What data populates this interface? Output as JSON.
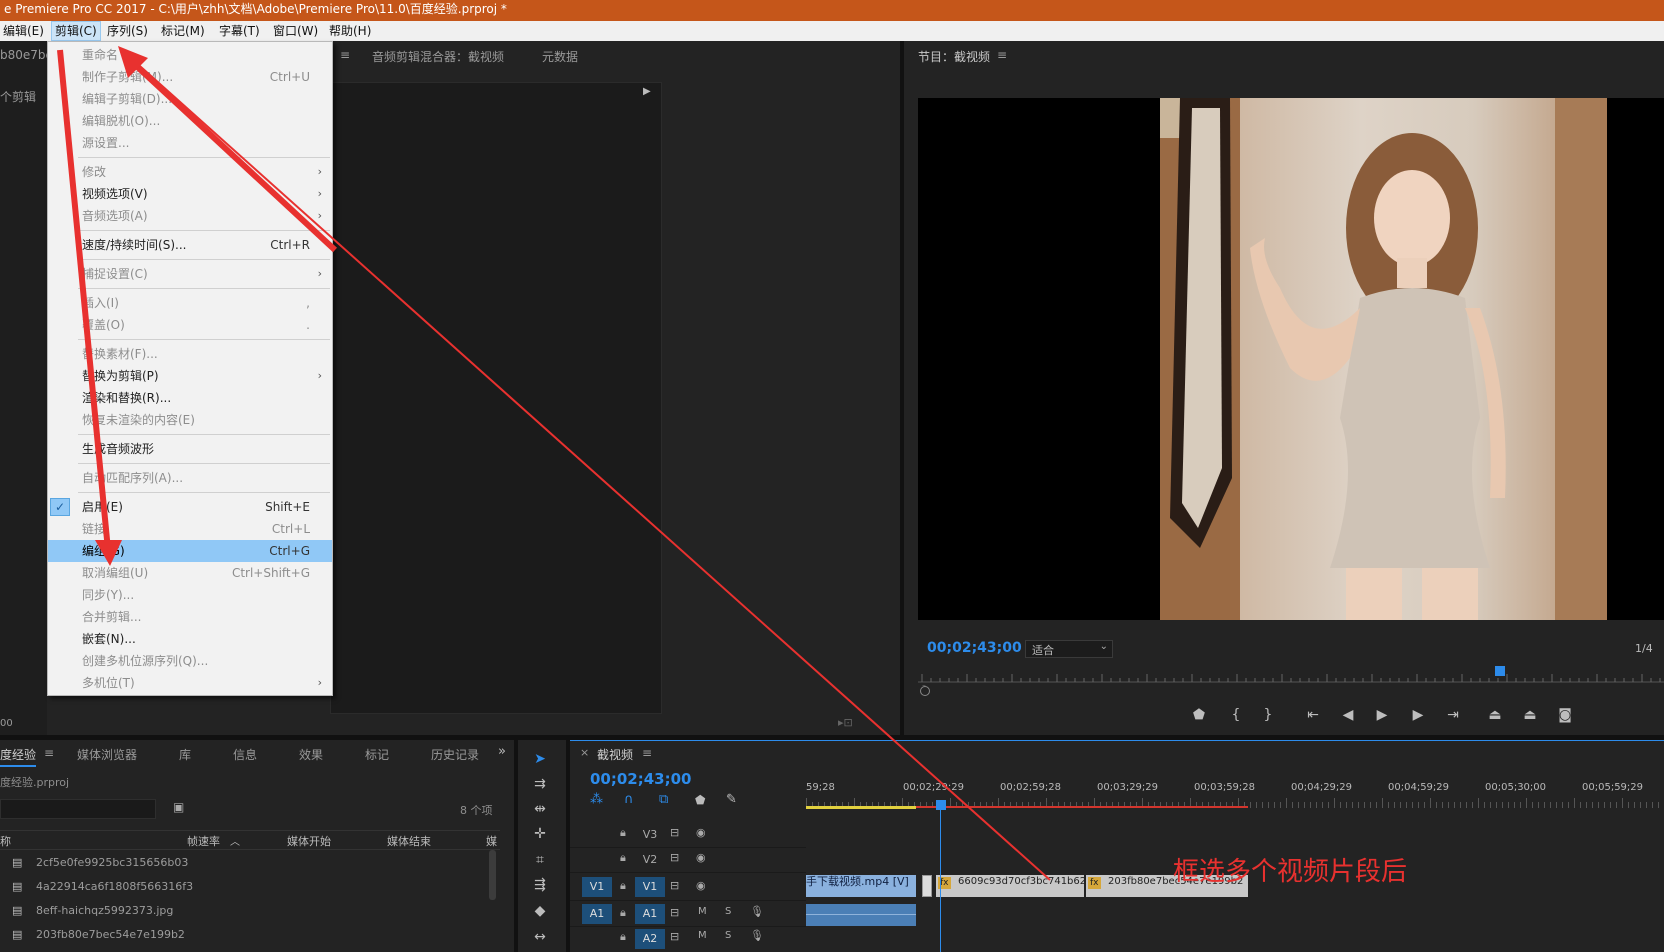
{
  "window": {
    "title": "e Premiere Pro CC 2017 - C:\\用户\\zhh\\文档\\Adobe\\Premiere Pro\\11.0\\百度经验.prproj *"
  },
  "menubar": {
    "items": [
      "编辑(E)",
      "剪辑(C)",
      "序列(S)",
      "标记(M)",
      "字幕(T)",
      "窗口(W)",
      "帮助(H)"
    ],
    "active": "剪辑(C)"
  },
  "source_panel": {
    "tab_partial": "b80e7bec",
    "tab_partial2": "个剪辑",
    "mixer_tab": "音频剪辑混合器：截视频",
    "metadata_tab": "元数据",
    "bottom_value": "00"
  },
  "clip_menu": {
    "items": [
      {
        "label": "重命名",
        "shortcut": "",
        "disabled": true
      },
      {
        "label": "制作子剪辑(M)...",
        "shortcut": "Ctrl+U",
        "disabled": true
      },
      {
        "label": "编辑子剪辑(D)...",
        "shortcut": "",
        "disabled": true
      },
      {
        "label": "编辑脱机(O)...",
        "shortcut": "",
        "disabled": true
      },
      {
        "label": "源设置...",
        "shortcut": "",
        "disabled": true
      },
      {
        "label": "修改",
        "shortcut": "",
        "disabled": true,
        "submenu": true
      },
      {
        "label": "视频选项(V)",
        "shortcut": "",
        "disabled": false,
        "submenu": true
      },
      {
        "label": "音频选项(A)",
        "shortcut": "",
        "disabled": true,
        "submenu": true
      },
      {
        "label": "速度/持续时间(S)...",
        "shortcut": "Ctrl+R",
        "disabled": false
      },
      {
        "label": "捕捉设置(C)",
        "shortcut": "",
        "disabled": true,
        "submenu": true
      },
      {
        "label": "插入(I)",
        "shortcut": ",",
        "disabled": true
      },
      {
        "label": "覆盖(O)",
        "shortcut": ".",
        "disabled": true
      },
      {
        "label": "替换素材(F)...",
        "shortcut": "",
        "disabled": true
      },
      {
        "label": "替换为剪辑(P)",
        "shortcut": "",
        "disabled": false,
        "submenu": true
      },
      {
        "label": "渲染和替换(R)...",
        "shortcut": "",
        "disabled": false
      },
      {
        "label": "恢复未渲染的内容(E)",
        "shortcut": "",
        "disabled": true
      },
      {
        "label": "生成音频波形",
        "shortcut": "",
        "disabled": false
      },
      {
        "label": "自动匹配序列(A)...",
        "shortcut": "",
        "disabled": true
      },
      {
        "label": "启用(E)",
        "shortcut": "Shift+E",
        "disabled": false,
        "checked": true
      },
      {
        "label": "链接",
        "shortcut": "Ctrl+L",
        "disabled": true
      },
      {
        "label": "编组(G)",
        "shortcut": "Ctrl+G",
        "disabled": false,
        "highlighted": true
      },
      {
        "label": "取消编组(U)",
        "shortcut": "Ctrl+Shift+G",
        "disabled": true
      },
      {
        "label": "同步(Y)...",
        "shortcut": "",
        "disabled": true
      },
      {
        "label": "合并剪辑...",
        "shortcut": "",
        "disabled": true
      },
      {
        "label": "嵌套(N)...",
        "shortcut": "",
        "disabled": false
      },
      {
        "label": "创建多机位源序列(Q)...",
        "shortcut": "",
        "disabled": true
      },
      {
        "label": "多机位(T)",
        "shortcut": "",
        "disabled": true,
        "submenu": true
      }
    ]
  },
  "program_monitor": {
    "title": "节目：截视频",
    "timecode": "00;02;43;00",
    "fit_label": "适合",
    "resolution": "1/4",
    "playhead_fraction": 0.78
  },
  "project_panel": {
    "tabs": [
      "度经验",
      "媒体浏览器",
      "库",
      "信息",
      "效果",
      "标记",
      "历史记录"
    ],
    "project_file": "度经验.prproj",
    "item_count": "8 个项",
    "columns": [
      "称",
      "帧速率",
      "媒体开始",
      "媒体结束",
      "媒"
    ],
    "rows": [
      "2cf5e0fe9925bc315656b03",
      "4a22914ca6f1808f566316f3",
      "8eff-haichqz5992373.jpg",
      "203fb80e7bec54e7e199b2"
    ]
  },
  "timeline": {
    "sequence_name": "截视频",
    "timecode": "00;02;43;00",
    "ruler": [
      "59;28",
      "00;02;29;29",
      "00;02;59;28",
      "00;03;29;29",
      "00;03;59;28",
      "00;04;29;29",
      "00;04;59;29",
      "00;05;30;00",
      "00;05;59;29",
      "00;"
    ],
    "tracks": [
      {
        "name": "V3",
        "kind": "video"
      },
      {
        "name": "V2",
        "kind": "video"
      },
      {
        "name": "V1",
        "kind": "video",
        "source": "V1"
      },
      {
        "name": "A1",
        "kind": "audio",
        "source": "A1"
      },
      {
        "name": "A2",
        "kind": "audio"
      }
    ],
    "clips": [
      {
        "label": "手下载视频.mp4 [V]"
      },
      {
        "label": "6609c93d70cf3bc741b62"
      },
      {
        "label": "203fb80e7bec54e7e199b2"
      }
    ],
    "track_m": "M",
    "track_s": "S",
    "fx_label": "fx"
  },
  "annotation": {
    "text": "框选多个视频片段后",
    "color": "#e8312f"
  }
}
